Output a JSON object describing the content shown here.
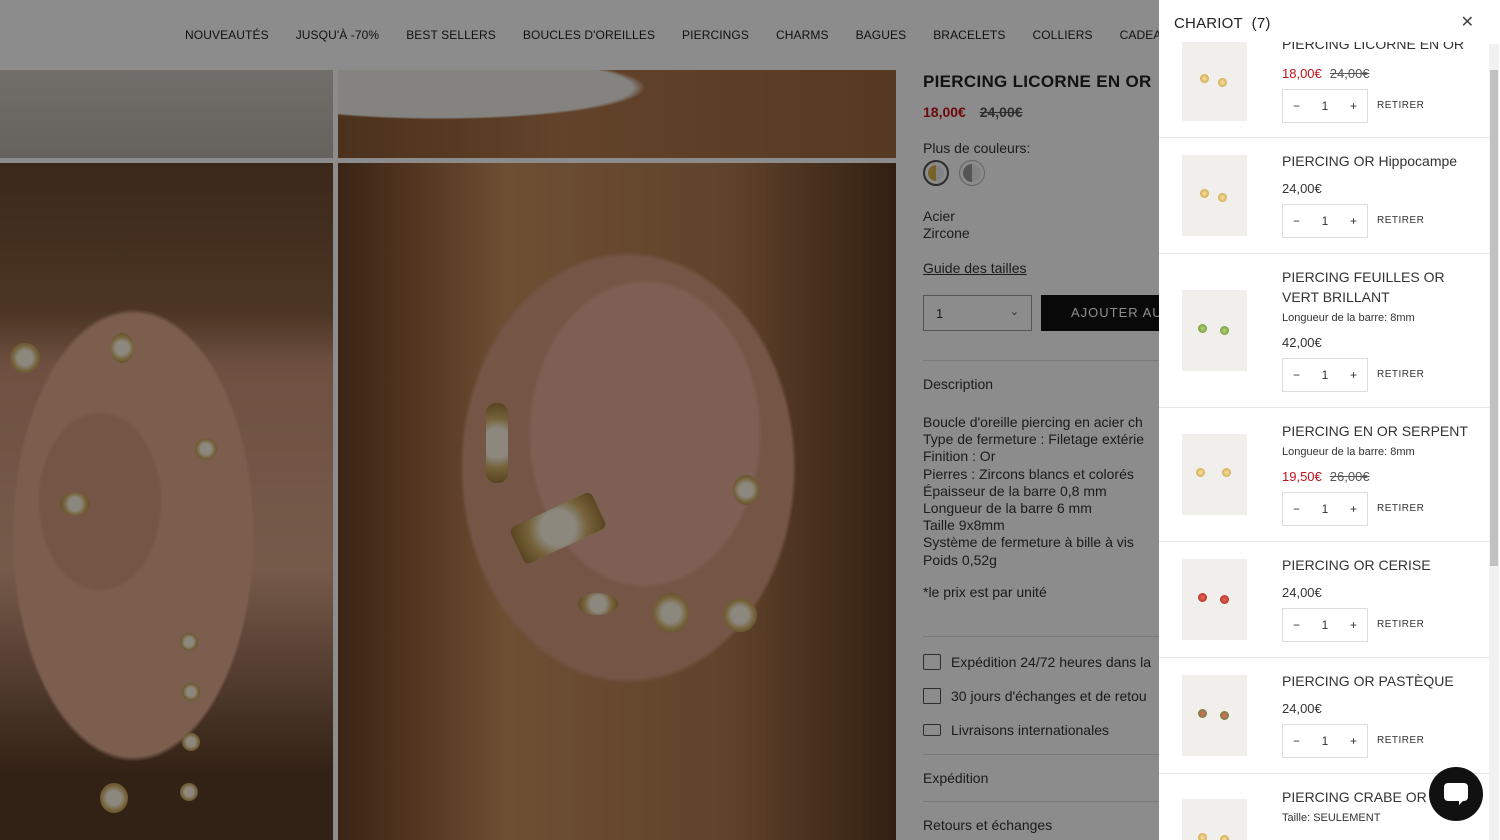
{
  "nav": [
    "NOUVEAUTÉS",
    "JUSQU'À -70%",
    "BEST SELLERS",
    "BOUCLES D'OREILLES",
    "PIERCINGS",
    "CHARMS",
    "BAGUES",
    "BRACELETS",
    "COLLIERS",
    "CADEAUX"
  ],
  "product": {
    "title": "PIERCING LICORNE EN OR",
    "sale_price": "18,00€",
    "old_price": "24,00€",
    "more_colors": "Plus de couleurs:",
    "material_1": "Acier",
    "material_2": "Zircone",
    "size_guide": "Guide des tailles",
    "qty": "1",
    "add_label": "AJOUTER AU",
    "description_label": "Description",
    "description_lines": [
      "Boucle d'oreille piercing en acier ch",
      "Type de fermeture : Filetage extérie",
      "Finition : Or",
      "Pierres : Zircons blancs et colorés",
      "Épaisseur de la barre 0,8 mm",
      "Longueur de la barre 6 mm",
      "Taille 9x8mm",
      "Système de fermeture à bille à vis",
      "Poids 0,52g"
    ],
    "note": "*le prix est par unité",
    "features": [
      "Expédition 24/72 heures dans la",
      "30 jours d'échanges et de retou",
      "Livraisons internationales"
    ],
    "shipping_label": "Expédition",
    "returns_label": "Retours et échanges"
  },
  "cart": {
    "title": "CHARIOT",
    "count": "(7)",
    "remove_label": "RETIRER",
    "items": [
      {
        "name": "PIERCING LICORNE EN OR",
        "variant": "",
        "price": "18,00€",
        "old_price": "24,00€",
        "qty": "1"
      },
      {
        "name": "PIERCING OR Hippocampe",
        "variant": "",
        "price": "24,00€",
        "old_price": "",
        "qty": "1"
      },
      {
        "name": "PIERCING FEUILLES OR VERT BRILLANT",
        "variant_label": "Longueur de la barre:",
        "variant_value": "8mm",
        "price": "42,00€",
        "old_price": "",
        "qty": "1"
      },
      {
        "name": "PIERCING EN OR SERPENT",
        "variant_label": "Longueur de la barre:",
        "variant_value": "8mm",
        "price": "19,50€",
        "old_price": "26,00€",
        "qty": "1"
      },
      {
        "name": "PIERCING OR CERISE",
        "variant": "",
        "price": "24,00€",
        "old_price": "",
        "qty": "1"
      },
      {
        "name": "PIERCING OR PASTÈQUE",
        "variant": "",
        "price": "24,00€",
        "old_price": "",
        "qty": "1"
      },
      {
        "name": "PIERCING CRABE OR",
        "variant_label": "Taille:",
        "variant_value": "SEULEMENT",
        "price": "",
        "old_price": "",
        "qty": ""
      }
    ]
  },
  "colors": {
    "sale": "#c4121a",
    "button": "#111111",
    "overlay": "rgba(0,0,0,0.45)"
  },
  "icons": [
    "close-icon",
    "minus-icon",
    "plus-icon",
    "chevron-down-icon",
    "shipping-icon",
    "box-icon",
    "truck-icon",
    "chat-icon"
  ]
}
